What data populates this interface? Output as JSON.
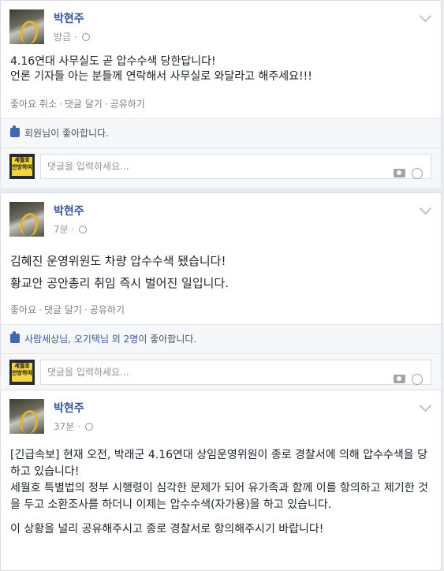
{
  "posts": [
    {
      "author": "박현주",
      "time": "방금",
      "lines": [
        "4.16연대 사무실도 곧 압수수색 당한답니다!",
        "언론 기자들 아는 분들께 연락해서 사무실로 와달라고 해주세요!!!"
      ],
      "actions": [
        "좋아요 취소",
        "댓글 달기",
        "공유하기"
      ],
      "likes_prefix": "",
      "likes_link": "",
      "likes_text": "회원님이 좋아합니다.",
      "comment_placeholder": "댓글을 입력하세요..."
    },
    {
      "author": "박현주",
      "time": "7분",
      "lines": [
        "김혜진 운영위원도 차량 압수수색 됐습니다!",
        "황교안 공안총리 취임 즉시 벌어진 일입니다."
      ],
      "actions": [
        "좋아요",
        "댓글 달기",
        "공유하기"
      ],
      "likes_link": "사람세상님, 오기택님 외 2명",
      "likes_text": "이 좋아합니다.",
      "comment_placeholder": "댓글을 입력하세요..."
    },
    {
      "author": "박현주",
      "time": "37분",
      "lines": [
        "[긴급속보] 현재 오전, 박래군 4.16연대 상임운영위원이 종로 경찰서에 의해 압수수색을 당하고 있습니다!",
        "세월호 특별법의 정부 시행령이 심각한 문제가 되어 유가족과 함께 이를 항의하고 제기한 것을 두고 소환조사를 하더니 이제는 압수수색(자가용)을 하고 있습니다.",
        "이 상황을 널리 공유해주시고 종로 경찰서로 항의해주시기 바랍니다!"
      ]
    }
  ]
}
